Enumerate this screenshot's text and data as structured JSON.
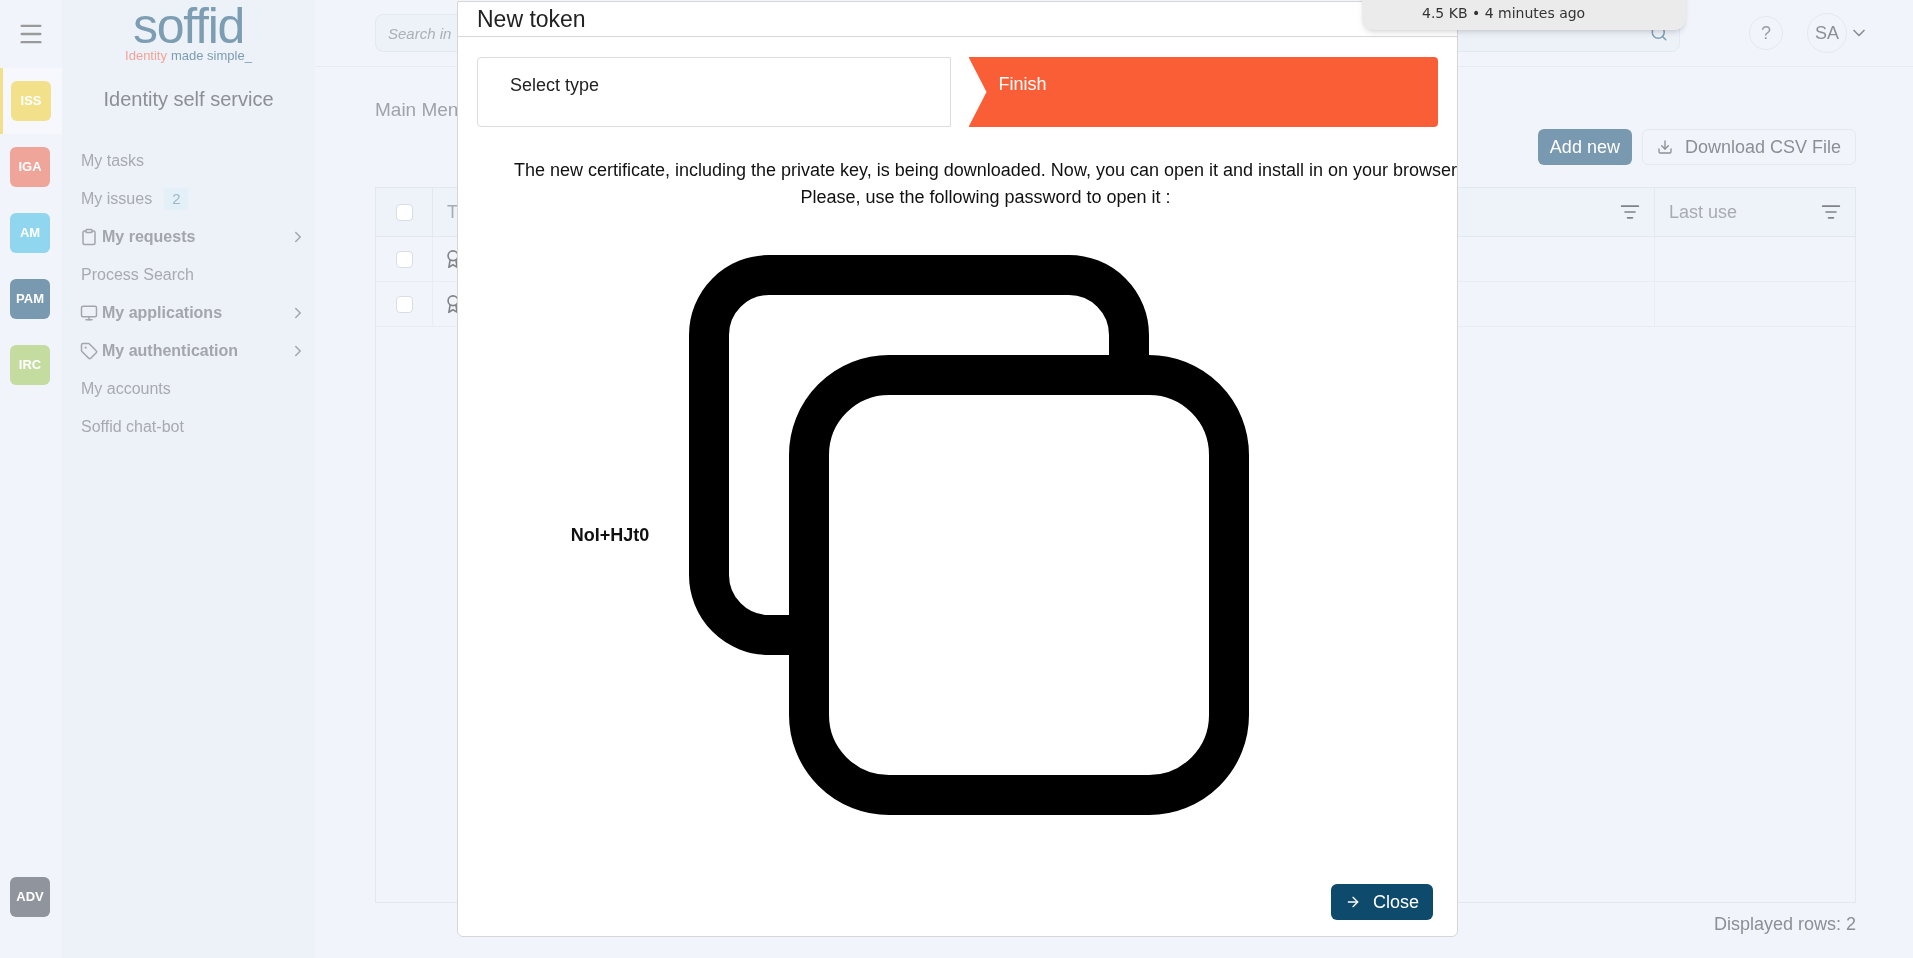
{
  "rail": {
    "items": [
      {
        "label": "ISS",
        "color": "#f2e08a",
        "selected": true
      },
      {
        "label": "IGA",
        "color": "#f0a59a",
        "selected": false
      },
      {
        "label": "AM",
        "color": "#8fd6ee",
        "selected": false
      },
      {
        "label": "PAM",
        "color": "#7899b0",
        "selected": false
      },
      {
        "label": "IRC",
        "color": "#c5dca0",
        "selected": false
      }
    ],
    "bottom": {
      "label": "ADV",
      "color": "#90949c",
      "selected": false
    }
  },
  "sidebar": {
    "logo": "soffid",
    "tagline_first": "Identity",
    "tagline_rest": "made simple_",
    "title": "Identity self service",
    "items": [
      {
        "label": "My tasks",
        "kind": "plain"
      },
      {
        "label": "My issues",
        "kind": "badge",
        "badge": "2"
      },
      {
        "label": "My requests",
        "kind": "group"
      },
      {
        "label": "Process Search",
        "kind": "plain"
      },
      {
        "label": "My applications",
        "kind": "group"
      },
      {
        "label": "My authentication",
        "kind": "group"
      },
      {
        "label": "My accounts",
        "kind": "plain"
      },
      {
        "label": "Soffid chat-bot",
        "kind": "plain"
      }
    ]
  },
  "header": {
    "search": {
      "placeholder": "Search in"
    },
    "help": "?",
    "avatar": "SA"
  },
  "download_popup": {
    "text": "4.5 KB • 4 minutes ago"
  },
  "breadcrumb": "Main Men",
  "toolbar": {
    "add": "Add new",
    "download": "Download CSV File"
  },
  "table": {
    "select_all": {
      "checked": false
    },
    "columns": [
      "T",
      "Last use"
    ],
    "rows": [
      {
        "checked": false
      },
      {
        "checked": false
      }
    ]
  },
  "footer": "Displayed rows: 2",
  "modal": {
    "title": "New token",
    "steps": [
      {
        "label": "Select type",
        "selected": false
      },
      {
        "label": "Finish",
        "selected": true
      }
    ],
    "message": [
      "The new certificate, including the private key, is being downloaded. Now, you can open it and install in on your browser",
      "Please, use the following password to open it :"
    ],
    "password": "NoI+HJt0",
    "close": "Close"
  }
}
